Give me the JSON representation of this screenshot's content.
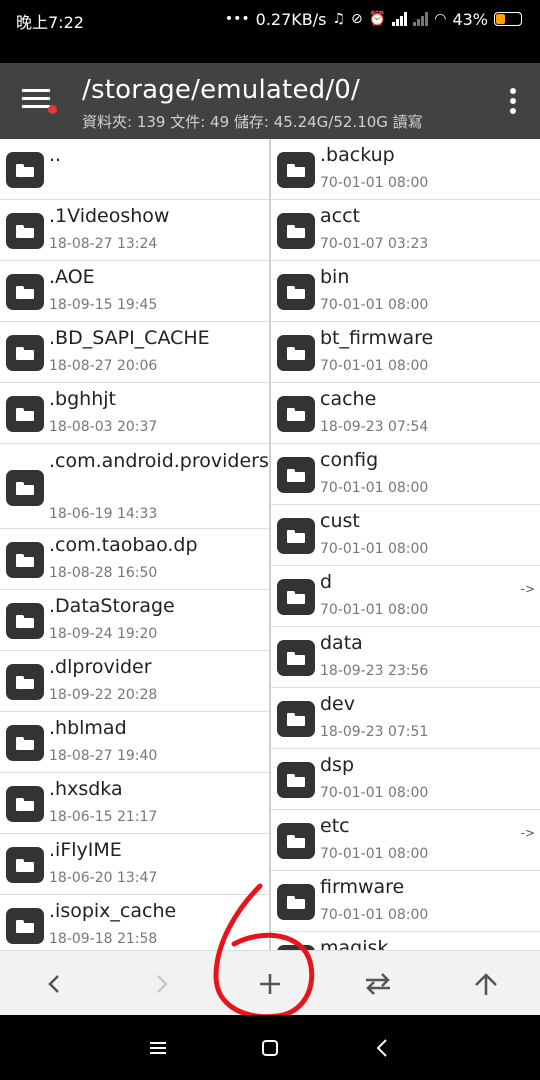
{
  "status_bar": {
    "time": "晚上7:22",
    "speed": "0.27KB/s",
    "battery": "43%"
  },
  "header": {
    "path": "/storage/emulated/0/",
    "info": "資料夾: 139  文件: 49  儲存: 45.24G/52.10G  讀寫"
  },
  "left_pane": [
    {
      "name": "..",
      "date": ""
    },
    {
      "name": ".1Videoshow",
      "date": "18-08-27 13:24"
    },
    {
      "name": ".AOE",
      "date": "18-09-15 19:45"
    },
    {
      "name": ".BD_SAPI_CACHE",
      "date": "18-08-27 20:06"
    },
    {
      "name": ".bghhjt",
      "date": "18-08-03 20:37"
    },
    {
      "name": ".com.android.providers.downloads.ui",
      "date": "18-06-19 14:33"
    },
    {
      "name": ".com.taobao.dp",
      "date": "18-08-28 16:50"
    },
    {
      "name": ".DataStorage",
      "date": "18-09-24 19:20"
    },
    {
      "name": ".dlprovider",
      "date": "18-09-22 20:28"
    },
    {
      "name": ".hblmad",
      "date": "18-08-27 19:40"
    },
    {
      "name": ".hxsdka",
      "date": "18-06-15 21:17"
    },
    {
      "name": ".iFlyIME",
      "date": "18-06-20 13:47"
    },
    {
      "name": ".isopix_cache",
      "date": "18-09-18 21:58"
    }
  ],
  "right_pane": [
    {
      "name": ".backup",
      "date": "70-01-01 08:00",
      "link": ""
    },
    {
      "name": "acct",
      "date": "70-01-07 03:23",
      "link": ""
    },
    {
      "name": "bin",
      "date": "70-01-01 08:00",
      "link": ""
    },
    {
      "name": "bt_firmware",
      "date": "70-01-01 08:00",
      "link": ""
    },
    {
      "name": "cache",
      "date": "18-09-23 07:54",
      "link": ""
    },
    {
      "name": "config",
      "date": "70-01-01 08:00",
      "link": ""
    },
    {
      "name": "cust",
      "date": "70-01-01 08:00",
      "link": ""
    },
    {
      "name": "d",
      "date": "70-01-01 08:00",
      "link": "->"
    },
    {
      "name": "data",
      "date": "18-09-23 23:56",
      "link": ""
    },
    {
      "name": "dev",
      "date": "18-09-23 07:51",
      "link": ""
    },
    {
      "name": "dsp",
      "date": "70-01-01 08:00",
      "link": ""
    },
    {
      "name": "etc",
      "date": "70-01-01 08:00",
      "link": "->"
    },
    {
      "name": "firmware",
      "date": "70-01-01 08:00",
      "link": ""
    },
    {
      "name": "magisk",
      "date": "",
      "link": ""
    }
  ],
  "toolbar": {
    "back_icon": "chevron-left",
    "forward_icon": "chevron-right",
    "add_icon": "plus",
    "swap_icon": "swap-arrows",
    "up_icon": "arrow-up",
    "annotation": "6",
    "annotation_color": "#e8141b"
  },
  "colors": {
    "header_bg": "#424242",
    "battery": "#ffa000",
    "menu_badge": "#e53935"
  }
}
